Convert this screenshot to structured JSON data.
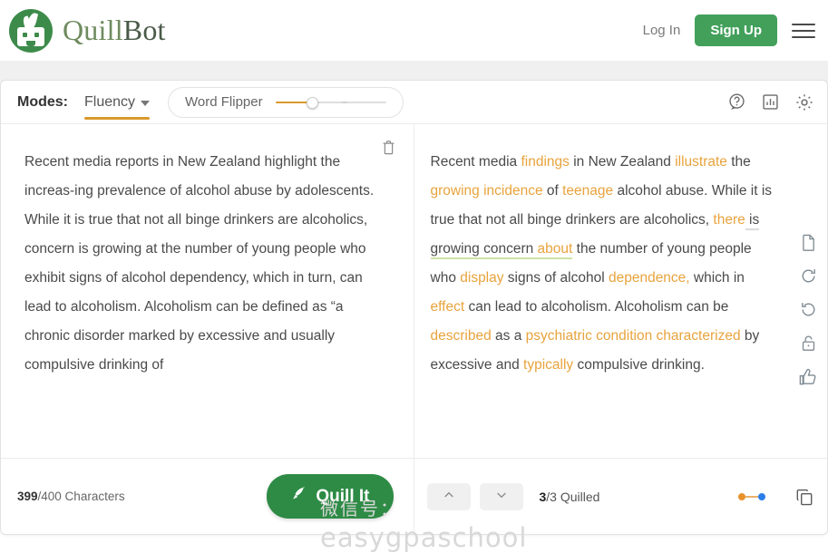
{
  "header": {
    "brand_quill": "Quill",
    "brand_bot": "Bot",
    "login_label": "Log In",
    "signup_label": "Sign Up",
    "logo_icon": "quillbot-robot-logo",
    "menu_icon": "hamburger-menu-icon"
  },
  "modes": {
    "label": "Modes:",
    "selected_mode": "Fluency",
    "dropdown_icon": "chevron-down-icon",
    "word_flipper_label": "Word Flipper",
    "slider_value": 33,
    "accent_color": "#d99a2b",
    "icons": {
      "help": "help-circle-icon",
      "stats": "bar-chart-icon",
      "settings": "gear-icon"
    }
  },
  "input_panel": {
    "delete_icon": "trash-icon",
    "text": "Recent media reports in New Zealand highlight the increas-ing prevalence of alcohol abuse by adolescents. While it is true that not all binge drinkers are alcoholics, concern is growing at the number of young people who exhibit signs of alcohol dependency, which in turn, can lead to alcoholism. Alcoholism can be defined as “a chronic disorder marked by excessive and usually compulsive drinking of"
  },
  "output_panel": {
    "segments": [
      {
        "t": "Recent media ",
        "k": "plain"
      },
      {
        "t": "findings",
        "k": "sug"
      },
      {
        "t": " in New Zealand ",
        "k": "plain"
      },
      {
        "t": "illustrate",
        "k": "sug"
      },
      {
        "t": " the ",
        "k": "plain"
      },
      {
        "t": "growing incidence",
        "k": "sug"
      },
      {
        "t": " of ",
        "k": "plain"
      },
      {
        "t": "teenage",
        "k": "sug"
      },
      {
        "t": " alcohol abuse. While it is true that not all binge drinkers are alcoholics, ",
        "k": "plain"
      },
      {
        "t": "there",
        "k": "sug"
      },
      {
        "t": " is",
        "k": "dotted"
      },
      {
        "t": " ",
        "k": "plain"
      },
      {
        "t": "growing concern ",
        "k": "underline"
      },
      {
        "t": "about",
        "k": "sug-underline"
      },
      {
        "t": " the number of young people who ",
        "k": "plain"
      },
      {
        "t": "display",
        "k": "sug"
      },
      {
        "t": " signs of alcohol ",
        "k": "plain"
      },
      {
        "t": "dependence,",
        "k": "sug"
      },
      {
        "t": " which in ",
        "k": "plain"
      },
      {
        "t": "effect",
        "k": "sug"
      },
      {
        "t": " can lead to alcoholism. Alcoholism can be ",
        "k": "plain"
      },
      {
        "t": "described",
        "k": "sug"
      },
      {
        "t": " as a ",
        "k": "plain"
      },
      {
        "t": "psychiatric condition characterized",
        "k": "sug"
      },
      {
        "t": " by excessive and ",
        "k": "plain"
      },
      {
        "t": "typically",
        "k": "sug"
      },
      {
        "t": " compulsive drinking.",
        "k": "plain"
      }
    ],
    "toolbar_icons": {
      "document": "document-icon",
      "redo": "redo-icon",
      "undo": "undo-icon",
      "lock": "lock-icon",
      "thumbs_up": "thumbs-up-icon"
    }
  },
  "watermark": {
    "line1": "微信号：",
    "line2": "easygpaschool"
  },
  "footer": {
    "char_current": "399",
    "char_total": "/400 Characters",
    "quill_button_label": "Quill It",
    "quill_icon": "quill-pen-icon",
    "prev_icon": "chevron-up-icon",
    "next_icon": "chevron-down-icon",
    "quilled_current": "3",
    "quilled_total": "/3 Quilled",
    "legend_dot_orange": "#e8912b",
    "legend_dot_blue": "#2b7de8",
    "copy_icon": "copy-icon"
  }
}
